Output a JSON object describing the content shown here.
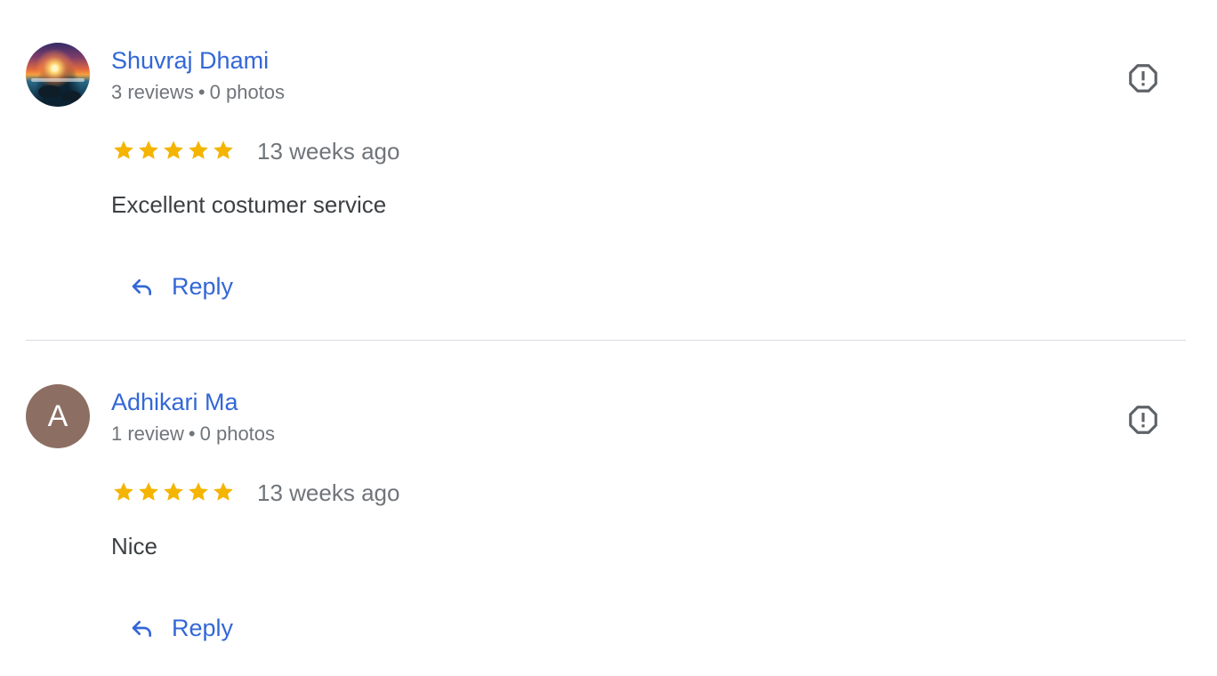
{
  "reviews": [
    {
      "author": "Shuvraj Dhami",
      "avatar_type": "photo",
      "reviews_count": "3 reviews",
      "separator": "•",
      "photos_count": "0 photos",
      "rating": 5,
      "rating_max": 5,
      "date": "13 weeks ago",
      "text": "Excellent costumer service",
      "reply_label": "Reply"
    },
    {
      "author": "Adhikari Ma",
      "avatar_type": "letter",
      "avatar_letter": "A",
      "reviews_count": "1 review",
      "separator": "•",
      "photos_count": "0 photos",
      "rating": 5,
      "rating_max": 5,
      "date": "13 weeks ago",
      "text": "Nice",
      "reply_label": "Reply"
    }
  ],
  "icons": {
    "flag": "report-flag-icon",
    "reply": "reply-arrow-icon",
    "star": "star-icon"
  },
  "colors": {
    "author_link": "#3367d6",
    "star": "#f4b400",
    "meta_text": "#70757a",
    "body_text": "#3c4043",
    "letter_avatar_bg": "#8d6e63",
    "divider": "#dadce0"
  }
}
